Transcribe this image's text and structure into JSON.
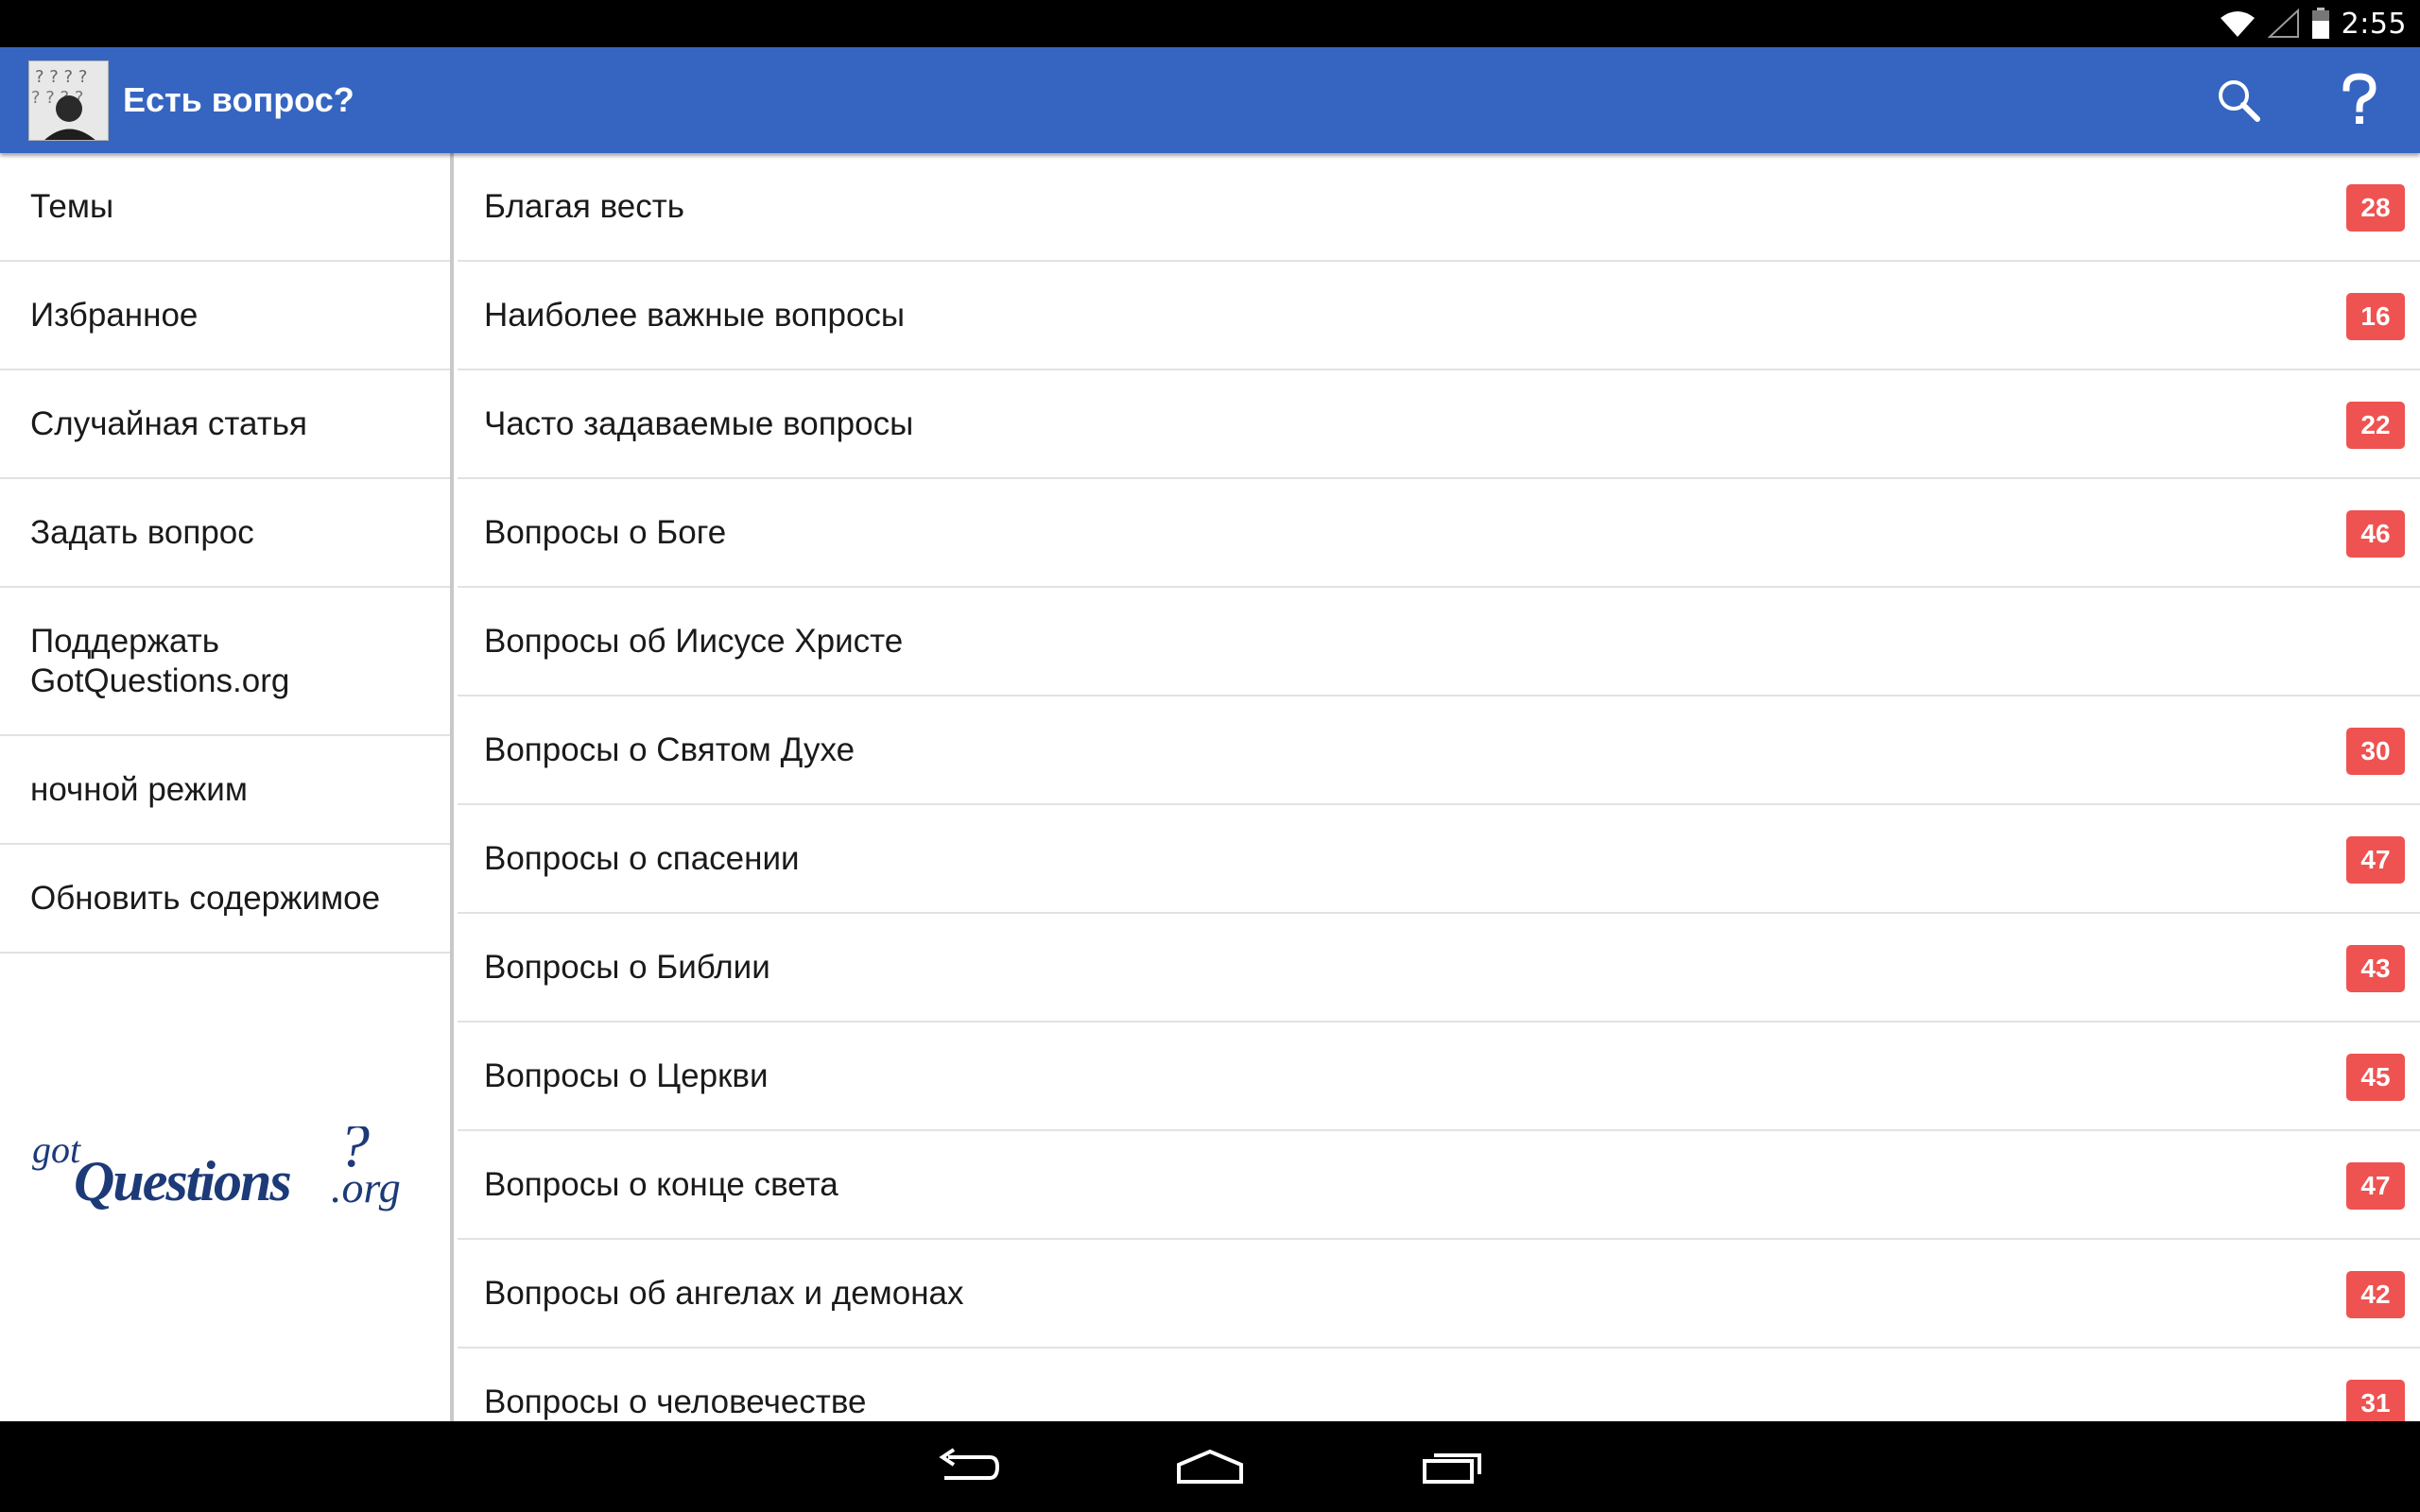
{
  "status_bar": {
    "time": "2:55",
    "icons": [
      "wifi-icon",
      "signal-icon",
      "battery-icon"
    ]
  },
  "action_bar": {
    "title": "Есть вопрос?",
    "background_color": "#3565c0",
    "actions": [
      {
        "name": "search",
        "icon": "search-icon"
      },
      {
        "name": "help",
        "icon": "help-icon"
      }
    ]
  },
  "sidebar": {
    "items": [
      {
        "label": "Темы"
      },
      {
        "label": "Избранное"
      },
      {
        "label": "Случайная статья"
      },
      {
        "label": "Задать вопрос"
      },
      {
        "label": "Поддержать GotQuestions.org"
      },
      {
        "label": "ночной режим"
      },
      {
        "label": "Обновить содержимое"
      }
    ],
    "logo": {
      "got": "got",
      "questions": "Questions",
      "org": ".org"
    }
  },
  "topics": [
    {
      "label": "Благая весть",
      "count": "28"
    },
    {
      "label": "Наиболее важные вопросы",
      "count": "16"
    },
    {
      "label": "Часто задаваемые вопросы",
      "count": "22"
    },
    {
      "label": "Вопросы о Боге",
      "count": "46"
    },
    {
      "label": "Вопросы об Иисусе Христе",
      "count": ""
    },
    {
      "label": "Вопросы о Святом Духе",
      "count": "30"
    },
    {
      "label": "Вопросы о спасении",
      "count": "47"
    },
    {
      "label": "Вопросы о Библии",
      "count": "43"
    },
    {
      "label": "Вопросы о Церкви",
      "count": "45"
    },
    {
      "label": "Вопросы о конце света",
      "count": "47"
    },
    {
      "label": "Вопросы об ангелах и демонах",
      "count": "42"
    },
    {
      "label": "Вопросы о человечестве",
      "count": "31"
    }
  ],
  "colors": {
    "accent": "#3565c0",
    "badge": "#ee5351"
  },
  "nav_bar": {
    "buttons": [
      "back-icon",
      "home-icon",
      "recents-icon"
    ]
  }
}
